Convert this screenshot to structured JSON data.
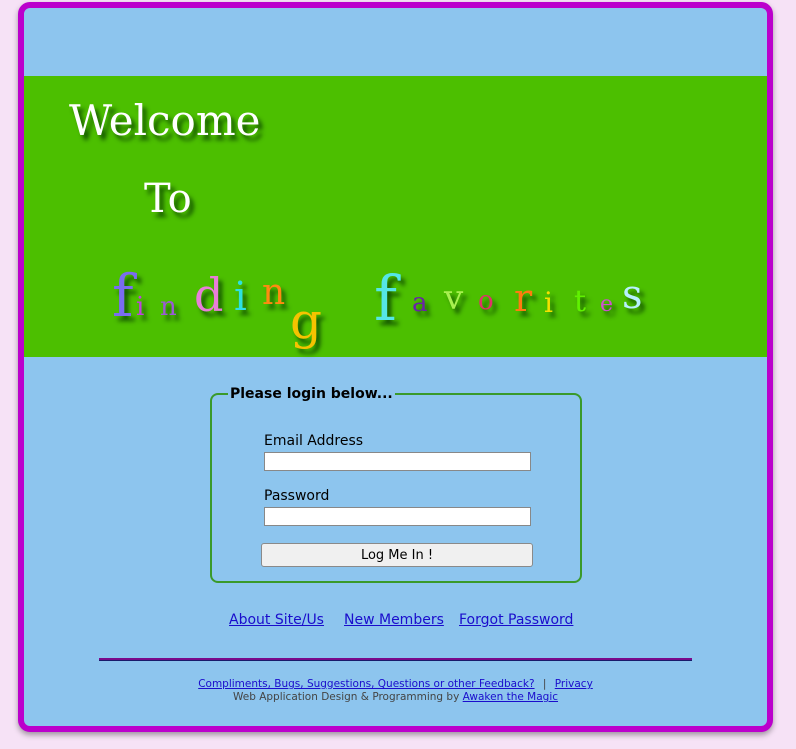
{
  "banner": {
    "welcome": "Welcome",
    "to": "To",
    "title_letters": [
      {
        "ch": "f",
        "color": "#7a6cf0"
      },
      {
        "ch": "i",
        "color": "#c040e0"
      },
      {
        "ch": "n",
        "color": "#9b59d8"
      },
      {
        "ch": "d",
        "color": "#e87ed8"
      },
      {
        "ch": "i",
        "color": "#2ee0e0"
      },
      {
        "ch": "n",
        "color": "#ff8a10"
      },
      {
        "ch": "g",
        "color": "#f5c300"
      },
      {
        "ch": "f",
        "color": "#55e6e6"
      },
      {
        "ch": "a",
        "color": "#6a22a8"
      },
      {
        "ch": "v",
        "color": "#a8f050"
      },
      {
        "ch": "o",
        "color": "#e0306a"
      },
      {
        "ch": "r",
        "color": "#ff7a10"
      },
      {
        "ch": "i",
        "color": "#f5e000"
      },
      {
        "ch": "t",
        "color": "#60f000"
      },
      {
        "ch": "e",
        "color": "#d050d0"
      },
      {
        "ch": "s",
        "color": "#b8f0ff"
      }
    ]
  },
  "login": {
    "legend": "Please login below...",
    "email_label": "Email Address",
    "email_value": "",
    "password_label": "Password",
    "password_value": "",
    "submit_label": "Log Me In !"
  },
  "nav": {
    "about": "About Site/Us",
    "new_members": "New Members",
    "forgot": "Forgot Password"
  },
  "footer": {
    "feedback": "Compliments, Bugs, Suggestions, Questions or other Feedback?",
    "separator": "|",
    "privacy": "Privacy",
    "credit_prefix": "Web Application Design & Programming by",
    "credit_link": "Awaken the Magic"
  },
  "colors": {
    "border": "#bb00cc",
    "page_bg": "#8dc5ee",
    "banner_bg": "#4cbf00",
    "link": "#1a0dcc"
  }
}
